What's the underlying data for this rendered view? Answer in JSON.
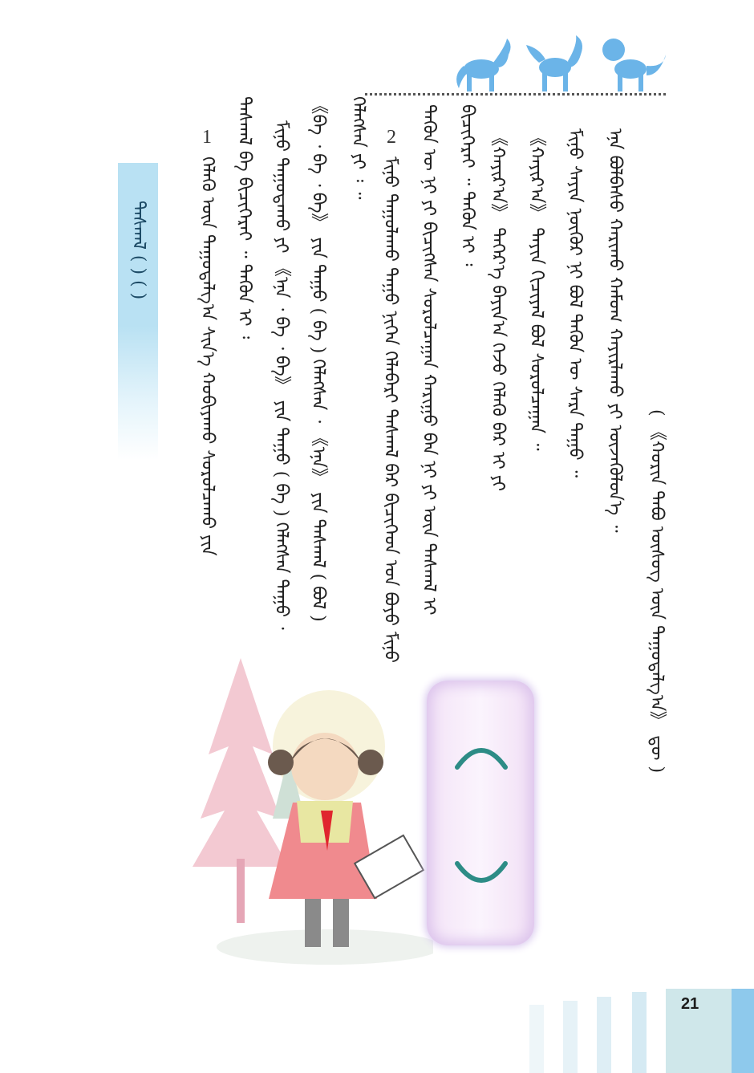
{
  "page_number": "21",
  "side_tab": {
    "label": "ᠳᠠᠰᠬᠠᠯ ( ) ( )"
  },
  "exercises": [
    {
      "number": "1"
    },
    {
      "number": "2"
    }
  ],
  "columns": [
    "( 《ᠬᠣᠷᠢᠨ ᠲᠠᠪᠤ ᠦᠰᠦᠭ ᠦᠨ ᠳᠠᠭᠤᠳᠠᠯᠭ᠎ᠠ》 ᠳᠦ )",
    "ᠡᠨᠡ ᠪᠣᠯᠪᠠᠰᠤ ᠬᠠᠷᠢᠬᠤ ᠬᠠᠮᠤᠭ ᠬᠠᠶᠢᠷᠯᠠᠬᠤ ᠶᠢ ᠦᠵᠡᠭᠦᠯᠦᠨ᠎ᠡ ᠃",
    "ᠮᠢᠨᠦ ᠰᠠᠶᠢᠨ ᠨᠥᠬᠦᠷ ᠨᠢ ᠪᠤᠯ ᠲᠡᠭᠦᠨ ᠦ ᠰᠠᠷᠠ ᠳᠠᠭᠤ ᠃",
    "《ᠬᠠᠶᠢᠷ᠎ᠠ》 ᠲᠡᠶᠢᠨ ᠬᠢᠴᠢᠶᠡᠯ ᠪᠤᠯ ᠰᠤᠷᠤᠯᠴᠠᠭᠠᠨ ᠃",
    "《ᠬᠠᠶᠢᠷ᠎ᠠ》 ᠳᠡᠭᠡᠷ᠎ᠡ ᠪᠠᠶᠢᠨ᠎ᠠ ᠭᠡᠵᠦ ᠬᠡᠯᠡᠬᠦ ᠪᠡᠷ ᠢ ᠶᠢ",
    "ᠪᠢᠴᠢᠭᠡᠷᠡᠢ ᠃ ᠲᠡᠭᠦᠨ ᠢ ᠄",
    "ᠲᠡᠭᠦᠨ ᠦ ᠨᠢ ᠶᠢ ᠪᠢᠴᠢᠭᠰᠡᠨ ᠰᠤᠷᠤᠯᠴᠠᠭᠠᠨ ᠬᠠᠷᠢᠭᠤ ᠪᠡᠨ ᠨᠢ ᠶᠢ ᠦᠨ ᠳᠠᠰᠬᠠᠯ ᠢ",
    "ᠮᠢᠨᠦ ᠲᠠᠭᠤᠯᠠᠬᠤ ᠳᠠᠭᠤ ᠨᠢᠭᠡᠨ ᠬᠡᠯᠡᠪᠡᠷᠢ ᠳᠠᠰᠬᠠᠯ ᠪᠠᠷ ᠪᠢᠴᠢᠭᠡᠳ ᠤᠨ ᠪᠤᠶᠤ ᠮᠢᠨᠦ",
    "ᠬᠡᠯᠡᠭᠰᠡᠨ ᠶᠢ ᠄ ᠃",
    "《ᠪᠠ ᠂ ᠪᠠ ᠂ ᠪᠠ》 ᠶᠢᠨ ᠳᠠᠭᠤ ( ᠪᠠ ) ᠬᠡᠯᠡᠭᠰᠡᠨ ᠂ 《ᠡᠨᠡ》 ᠶᠢᠨ ᠳᠠᠰᠬᠠᠯ ( ᠪᠣᠯ )",
    "ᠮᠢᠨᠦ ᠳᠠᠭᠤᠳᠠᠬᠤ ᠶᠢ 《ᠡᠨᠡ ᠂ ᠪᠠ ᠂ ᠪᠠ》 ᠶᠢᠨ ᠳᠠᠭᠤ ( ᠪᠠ ) ᠬᠡᠯᠡᠭᠰᠡᠨ ᠳᠠᠭᠤ ᠂",
    "ᠳᠠᠰᠬᠠᠯ ᠪᠠ ᠪᠢᠴᠢᠭᠡᠷᠡᠢ ᠃ ᠲᠡᠭᠦᠨ ᠢ ᠄",
    "ᠬᠡᠯᠡᠬᠦ ᠦᠨ ᠳᠠᠭᠤᠳᠠᠯᠭ᠎ᠠ ᠰᠢᠨ᠎ᠡ ᠬᠤᠪᠢᠶᠠᠬᠤ ᠰᠤᠷᠤᠯᠴᠠᠬᠤ ᠶᠢᠨ"
  ],
  "colors": {
    "accent_blue": "#8ec9ec",
    "tab_blue": "#b9e1f3",
    "bubble_pink": "#f3e3f7",
    "arc_teal": "#2d8c86",
    "pony_blue": "#6bb4e8"
  },
  "icons": [
    "pony-silhouette-icon",
    "pony-silhouette-icon",
    "pony-silhouette-icon",
    "open-parenthesis-arc-icon",
    "close-parenthesis-arc-icon"
  ]
}
